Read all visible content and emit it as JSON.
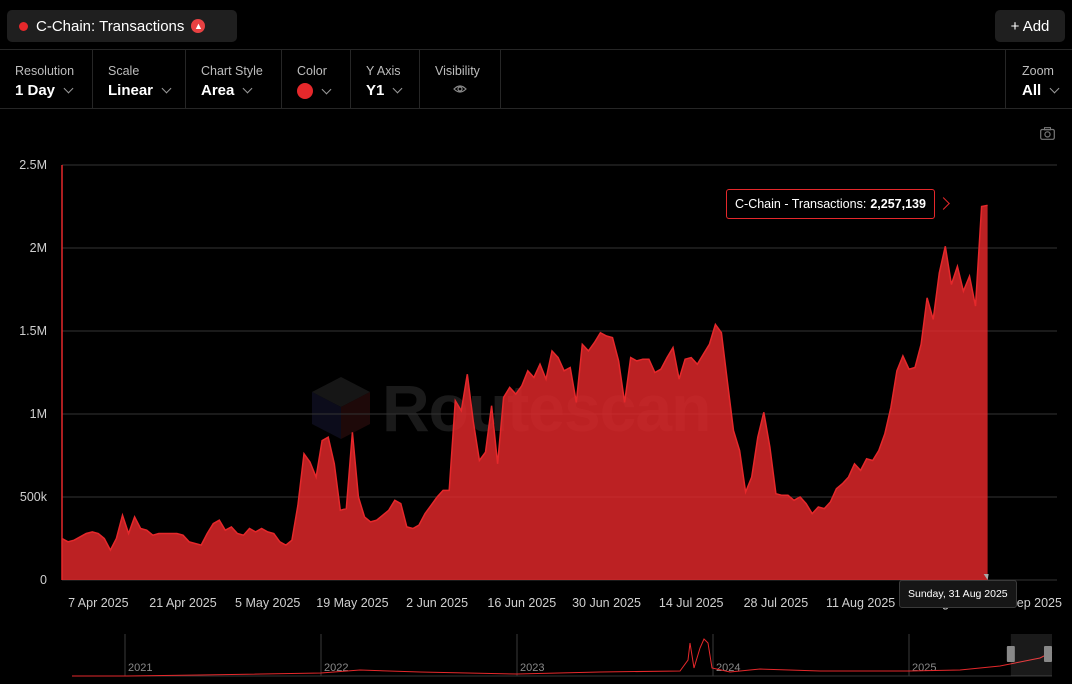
{
  "header": {
    "series_title": "C-Chain: Transactions",
    "add_label": "+ Add"
  },
  "toolbar": {
    "resolution": {
      "label": "Resolution",
      "value": "1 Day"
    },
    "scale": {
      "label": "Scale",
      "value": "Linear"
    },
    "chart_style": {
      "label": "Chart Style",
      "value": "Area"
    },
    "color": {
      "label": "Color",
      "value": "#e5282b"
    },
    "y_axis": {
      "label": "Y Axis",
      "value": "Y1"
    },
    "visibility": {
      "label": "Visibility"
    },
    "zoom": {
      "label": "Zoom",
      "value": "All"
    }
  },
  "watermark": "Routescan",
  "tooltip": {
    "series": "C-Chain - Transactions:",
    "value": "2,257,139",
    "date": "Sunday, 31 Aug 2025"
  },
  "chart_data": {
    "type": "area",
    "color": "#e5282b",
    "y_ticks": [
      "0",
      "500k",
      "1M",
      "1.5M",
      "2M",
      "2.5M"
    ],
    "ylim": [
      0,
      2500000
    ],
    "x_ticks": [
      "7 Apr 2025",
      "21 Apr 2025",
      "5 May 2025",
      "19 May 2025",
      "2 Jun 2025",
      "16 Jun 2025",
      "30 Jun 2025",
      "14 Jul 2025",
      "28 Jul 2025",
      "11 Aug 2025",
      "25 Aug 2025",
      "8 Sep 2025"
    ],
    "x_tick_days": [
      6,
      20,
      34,
      48,
      62,
      76,
      90,
      104,
      118,
      132,
      146,
      160
    ],
    "series": [
      {
        "values": [
          250000,
          230000,
          240000,
          260000,
          280000,
          290000,
          280000,
          250000,
          180000,
          250000,
          390000,
          280000,
          380000,
          310000,
          300000,
          270000,
          280000,
          280000,
          280000,
          280000,
          270000,
          230000,
          220000,
          210000,
          280000,
          340000,
          360000,
          300000,
          320000,
          280000,
          270000,
          310000,
          290000,
          310000,
          290000,
          280000,
          230000,
          210000,
          240000,
          450000,
          760000,
          710000,
          620000,
          840000,
          860000,
          700000,
          420000,
          430000,
          890000,
          500000,
          380000,
          350000,
          360000,
          390000,
          420000,
          480000,
          460000,
          320000,
          310000,
          330000,
          400000,
          450000,
          500000,
          540000,
          540000,
          1080000,
          1020000,
          1240000,
          950000,
          720000,
          770000,
          1050000,
          700000,
          1100000,
          1160000,
          1120000,
          1170000,
          1260000,
          1220000,
          1300000,
          1210000,
          1380000,
          1340000,
          1260000,
          1280000,
          1070000,
          1420000,
          1380000,
          1430000,
          1490000,
          1470000,
          1460000,
          1320000,
          1070000,
          1340000,
          1320000,
          1330000,
          1330000,
          1250000,
          1270000,
          1340000,
          1400000,
          1210000,
          1330000,
          1340000,
          1300000,
          1360000,
          1420000,
          1540000,
          1490000,
          1190000,
          900000,
          780000,
          530000,
          620000,
          860000,
          1010000,
          800000,
          520000,
          510000,
          510000,
          480000,
          500000,
          460000,
          400000,
          440000,
          430000,
          470000,
          550000,
          580000,
          620000,
          700000,
          660000,
          730000,
          720000,
          780000,
          880000,
          1040000,
          1260000,
          1350000,
          1270000,
          1280000,
          1420000,
          1700000,
          1570000,
          1850000,
          2010000,
          1780000,
          1890000,
          1740000,
          1830000,
          1650000,
          2250000,
          2257139
        ],
        "zoom_window": [
          0.958,
          1.0
        ]
      }
    ],
    "overview_years": [
      "2021",
      "2022",
      "2023",
      "2024",
      "2025"
    ]
  }
}
